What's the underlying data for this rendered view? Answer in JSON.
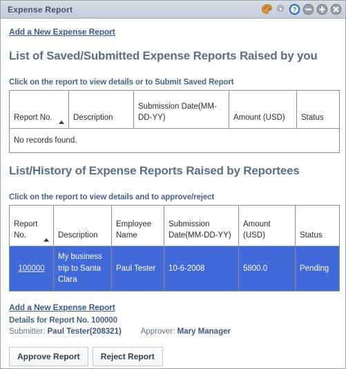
{
  "window": {
    "title": "Expense Report",
    "icons": [
      {
        "name": "theme-palette-icon",
        "glyph": "palette"
      },
      {
        "name": "settings-gear-icon",
        "glyph": "gear"
      },
      {
        "name": "help-icon",
        "glyph": "question"
      },
      {
        "name": "minimize-icon",
        "glyph": "minus"
      },
      {
        "name": "maximize-icon",
        "glyph": "plus"
      },
      {
        "name": "close-icon",
        "glyph": "cross"
      }
    ]
  },
  "top_link": "Add a New Expense Report",
  "section_own": {
    "title": "List of Saved/Submitted Expense Reports Raised by you",
    "hint": "Click on the report to view details or to Submit Saved Report",
    "columns": [
      "Report No.",
      "Description",
      "Submission Date(MM-DD-YY)",
      "Amount (USD)",
      "Status"
    ],
    "sorted_column": "Report No.",
    "sort_direction": "ascending",
    "rows": [],
    "empty_message": "No records found."
  },
  "section_reportees": {
    "title": "List/History of Expense Reports Raised by Reportees",
    "hint": "Click on the report to view details and to approve/reject",
    "columns": [
      "Report No.",
      "Description",
      "Employee Name",
      "Submission Date(MM-DD-YY)",
      "Amount (USD)",
      "Status"
    ],
    "sorted_column": "Report No.",
    "sort_direction": "ascending",
    "rows": [
      {
        "report_no": "100000",
        "description": "My business trip to Santa Clara",
        "employee_name": "Paul Tester",
        "submission_date": "10-6-2008",
        "amount": "5800.0",
        "status": "Pending",
        "selected": true
      }
    ]
  },
  "bottom_link": "Add a New Expense Report",
  "details": {
    "heading": "Details for Report No. 100000",
    "submitter_label": "Submitter:",
    "submitter_value": "Paul Tester(208321)",
    "approver_label": "Approver:",
    "approver_value": "Mary Manager"
  },
  "actions": {
    "approve_label": "Approve Report",
    "reject_label": "Reject Report"
  },
  "colors": {
    "selection_blue": "#4169d8",
    "heading_blue": "#5b6f86",
    "link_blue": "#3a5a8c",
    "titlebar_gray": "#ccd4de"
  }
}
